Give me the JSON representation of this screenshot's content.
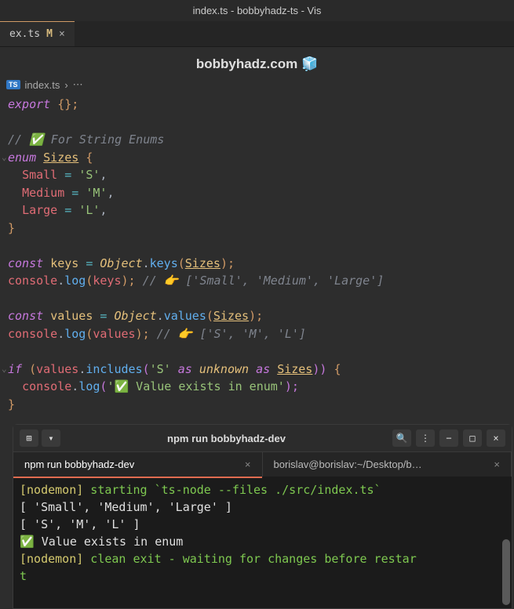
{
  "window": {
    "title": "index.ts - bobbyhadz-ts - Vis"
  },
  "tab": {
    "name": "ex.ts",
    "modified": "M",
    "close": "×"
  },
  "watermark": {
    "text": "bobbyhadz.com 🧊"
  },
  "breadcrumb": {
    "file": "index.ts",
    "sep": "›",
    "more": "⋯"
  },
  "code": {
    "l1": {
      "kw": "export",
      "rest": " {};"
    },
    "l2": "",
    "l3": "// ✅ For String Enums",
    "l4": {
      "kw": "enum",
      "name": "Sizes",
      "brace": "{"
    },
    "l5": {
      "key": "Small",
      "eq": "=",
      "val": "'S'",
      "comma": ","
    },
    "l6": {
      "key": "Medium",
      "eq": "=",
      "val": "'M'",
      "comma": ","
    },
    "l7": {
      "key": "Large",
      "eq": "=",
      "val": "'L'",
      "comma": ","
    },
    "l8": "}",
    "l9": "",
    "l10": {
      "kw": "const",
      "name": "keys",
      "eq": "=",
      "obj": "Object",
      "dot": ".",
      "fn": "keys",
      "p1": "(",
      "arg": "Sizes",
      "p2": ");"
    },
    "l11": {
      "obj": "console",
      "dot": ".",
      "fn": "log",
      "p1": "(",
      "arg": "keys",
      "p2": ");",
      "comment": "// 👉️ ['Small', 'Medium', 'Large']"
    },
    "l12": "",
    "l13": {
      "kw": "const",
      "name": "values",
      "eq": "=",
      "obj": "Object",
      "dot": ".",
      "fn": "values",
      "p1": "(",
      "arg": "Sizes",
      "p2": ");"
    },
    "l14": {
      "obj": "console",
      "dot": ".",
      "fn": "log",
      "p1": "(",
      "arg": "values",
      "p2": ");",
      "comment": "// 👉️ ['S', 'M', 'L']"
    },
    "l15": "",
    "l16": {
      "kw": "if",
      "p1": "(",
      "obj": "values",
      "dot": ".",
      "fn": "includes",
      "p2": "(",
      "str": "'S'",
      "as1": "as",
      "t1": "unknown",
      "as2": "as",
      "t2": "Sizes",
      "p3": "))",
      "brace": "{"
    },
    "l17": {
      "obj": "console",
      "dot": ".",
      "fn": "log",
      "p1": "(",
      "str": "'✅ Value exists in enum'",
      "p2": ");"
    },
    "l18": "}"
  },
  "terminal": {
    "title": "npm run bobbyhadz-dev",
    "newTab": "⊞",
    "dropdown": "▾",
    "search": "🔍",
    "menu": "⋮",
    "min": "−",
    "max": "□",
    "close": "×",
    "tabs": {
      "t1": "npm run bobbyhadz-dev",
      "t2": "borislav@borislav:~/Desktop/b…"
    },
    "output": {
      "l1a": "[nodemon]",
      "l1b": " starting ",
      "l1c": "`ts-node --files ./src/index.ts`",
      "l2": "[ 'Small', 'Medium', 'Large' ]",
      "l3": "[ 'S', 'M', 'L' ]",
      "l4": "✅ Value exists in enum",
      "l5a": "[nodemon]",
      "l5b": " clean exit - waiting for changes before restar",
      "l6": "t"
    }
  }
}
